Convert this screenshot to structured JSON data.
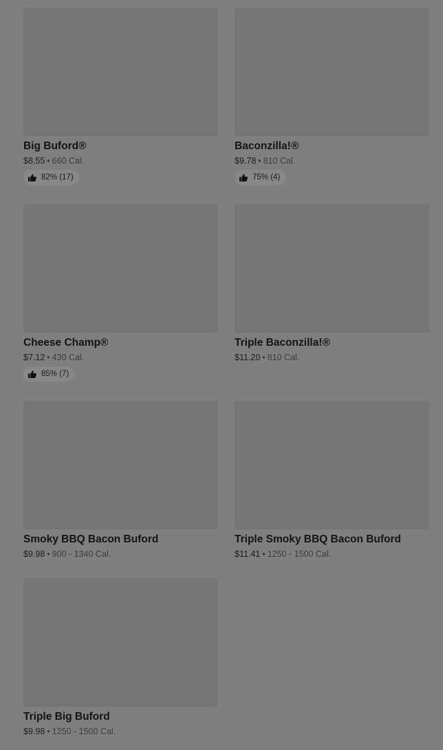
{
  "menu": {
    "items": [
      {
        "name": "Big Buford®",
        "price": "$8.55",
        "sep": "•",
        "calories": "660 Cal.",
        "rating": "82% (17)"
      },
      {
        "name": "Baconzilla!®",
        "price": "$9.78",
        "sep": "•",
        "calories": "810 Cal.",
        "rating": "75% (4)"
      },
      {
        "name": "Cheese Champ®",
        "price": "$7.12",
        "sep": "•",
        "calories": "430 Cal.",
        "rating": "85% (7)"
      },
      {
        "name": "Triple Baconzilla!®",
        "price": "$11.20",
        "sep": "•",
        "calories": "810 Cal."
      },
      {
        "name": "Smoky BBQ Bacon Buford",
        "price": "$9.98",
        "sep": "•",
        "calories": "900 - 1340 Cal."
      },
      {
        "name": "Triple Smoky BBQ Bacon Buford",
        "price": "$11.41",
        "sep": "•",
        "calories": "1250 - 1500 Cal."
      },
      {
        "name": "Triple Big Buford",
        "price": "$9.98",
        "sep": "•",
        "calories": "1250 - 1500 Cal."
      }
    ]
  },
  "icons": {
    "rating_icon": "thumbs-up-icon"
  },
  "colors": {
    "background": "#7f7f7f",
    "image_placeholder": "#757575",
    "rating_pill": "#888888"
  }
}
